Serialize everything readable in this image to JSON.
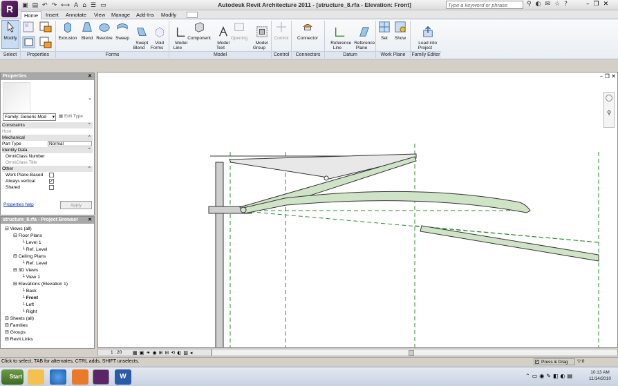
{
  "window": {
    "title": "Autodesk Revit Architecture 2011 - [structure_8.rfa - Elevation: Front]",
    "search_placeholder": "Type a keyword or phrase",
    "logo_letter": "R"
  },
  "tabs": [
    {
      "label": "Home"
    },
    {
      "label": "Insert"
    },
    {
      "label": "Annotate"
    },
    {
      "label": "View"
    },
    {
      "label": "Manage"
    },
    {
      "label": "Add-Ins"
    },
    {
      "label": "Modify"
    }
  ],
  "ribbon": {
    "buttons": [
      {
        "label": "Modify"
      },
      {
        "label": "Extrusion"
      },
      {
        "label": "Blend"
      },
      {
        "label": "Revolve"
      },
      {
        "label": "Sweep"
      },
      {
        "label": "Swept\nBlend"
      },
      {
        "label": "Void\nForms"
      },
      {
        "label": "Model\nLine"
      },
      {
        "label": "Component"
      },
      {
        "label": "Model\nText"
      },
      {
        "label": "Opening"
      },
      {
        "label": "Model\nGroup"
      },
      {
        "label": "Control"
      },
      {
        "label": "Connector"
      },
      {
        "label": "Reference\nLine"
      },
      {
        "label": "Reference\nPlane"
      },
      {
        "label": "Set"
      },
      {
        "label": "Show"
      },
      {
        "label": "Load into\nProject"
      }
    ],
    "panels": [
      {
        "label": "Select"
      },
      {
        "label": "Properties"
      },
      {
        "label": "Forms"
      },
      {
        "label": "Model"
      },
      {
        "label": "Control"
      },
      {
        "label": "Connectors"
      },
      {
        "label": "Datum"
      },
      {
        "label": "Work Plane"
      },
      {
        "label": "Family Editor"
      }
    ]
  },
  "properties": {
    "title": "Properties",
    "type_selector": "Family: Generic Mod",
    "edit_type": "Edit Type",
    "rows": [
      {
        "label": "Constraints",
        "value": "",
        "cat": true
      },
      {
        "label": "Host",
        "value": ""
      },
      {
        "label": "Mechanical",
        "value": "",
        "cat": true
      },
      {
        "label": "Part Type",
        "value": "Normal"
      },
      {
        "label": "Identity Data",
        "value": "",
        "cat": true
      },
      {
        "label": "OmniClass Number",
        "value": ""
      },
      {
        "label": "OmniClass Title",
        "value": ""
      },
      {
        "label": "Other",
        "value": "",
        "cat": true
      },
      {
        "label": "Work Plane-Based",
        "value": ""
      },
      {
        "label": "Always vertical",
        "value": "✓"
      },
      {
        "label": "Shared",
        "value": ""
      }
    ],
    "help_link": "Properties help",
    "apply": "Apply"
  },
  "browser": {
    "title": "structure_8.rfa - Project Browser",
    "items": [
      {
        "label": "Views (all)",
        "indent": 0,
        "bold": false
      },
      {
        "label": "Floor Plans",
        "indent": 1,
        "bold": false
      },
      {
        "label": "Level 1",
        "indent": 2,
        "bold": false
      },
      {
        "label": "Ref. Level",
        "indent": 2,
        "bold": false
      },
      {
        "label": "Ceiling Plans",
        "indent": 1,
        "bold": false
      },
      {
        "label": "Ref. Level",
        "indent": 2,
        "bold": false
      },
      {
        "label": "3D Views",
        "indent": 1,
        "bold": false
      },
      {
        "label": "View 1",
        "indent": 2,
        "bold": false
      },
      {
        "label": "Elevations (Elevation 1)",
        "indent": 1,
        "bold": false
      },
      {
        "label": "Back",
        "indent": 2,
        "bold": false
      },
      {
        "label": "Front",
        "indent": 2,
        "bold": true
      },
      {
        "label": "Left",
        "indent": 2,
        "bold": false
      },
      {
        "label": "Right",
        "indent": 2,
        "bold": false
      },
      {
        "label": "Sheets (all)",
        "indent": 0,
        "bold": false
      },
      {
        "label": "Families",
        "indent": 0,
        "bold": false
      },
      {
        "label": "Groups",
        "indent": 0,
        "bold": false
      },
      {
        "label": "Revit Links",
        "indent": 0,
        "bold": false
      }
    ]
  },
  "view_control": {
    "scale": "1 : 20"
  },
  "status": {
    "message": "Click to select, TAB for alternates, CTRL adds, SHIFT unselects.",
    "press_drag": "Press & Drag",
    "filter_count": ":0"
  },
  "taskbar": {
    "start": "Start",
    "time": "10:13 AM",
    "date": "11/14/2010"
  },
  "colors": {
    "ref_plane": "#2e8b2e",
    "member_fill": "#cfe3c7",
    "title_accent": "#9fb4cc"
  }
}
